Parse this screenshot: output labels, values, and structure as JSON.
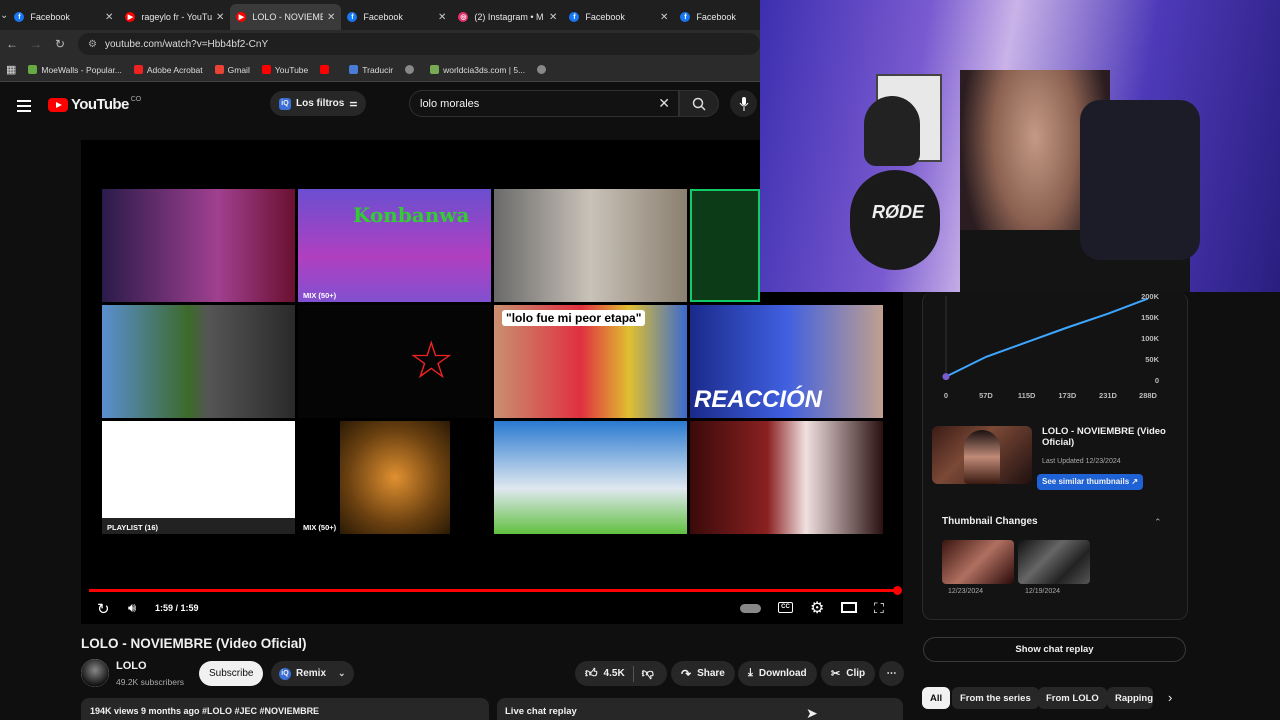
{
  "browser": {
    "tabs": [
      {
        "title": "Facebook",
        "icon": "facebook-icon",
        "color": "#1877f2"
      },
      {
        "title": "rageylo fr - YouTu",
        "icon": "youtube-icon",
        "color": "#ff0000"
      },
      {
        "title": "LOLO - NOVIEMB",
        "icon": "youtube-icon",
        "color": "#ff0000"
      },
      {
        "title": "Facebook",
        "icon": "facebook-icon",
        "color": "#1877f2"
      },
      {
        "title": "(2) Instagram • M",
        "icon": "instagram-icon",
        "color": "#e1306c"
      },
      {
        "title": "Facebook",
        "icon": "facebook-icon",
        "color": "#1877f2"
      },
      {
        "title": "Facebook",
        "icon": "facebook-icon",
        "color": "#1877f2"
      }
    ],
    "url": "youtube.com/watch?v=Hbb4bf2-CnY",
    "bookmarks": [
      "MoeWalls - Popular...",
      "Adobe Acrobat",
      "Gmail",
      "YouTube",
      "",
      "Traducir",
      "",
      "worldcia3ds.com | 5...",
      ""
    ]
  },
  "youtube": {
    "filters_label": "Los filtros",
    "search_value": "lolo morales",
    "player": {
      "end_labels": [
        "MIX (50+)",
        "PLAYLIST (16)",
        "MIX (50+)"
      ],
      "time": "1:59 / 1:59",
      "progress": 1.0
    },
    "video": {
      "title": "LOLO - NOVIEMBRE (Video Oficial)",
      "channel": "LOLO",
      "subscribers": "49.2K subscribers",
      "subscribe": "Subscribe",
      "remix": "Remix",
      "likes": "4.5K",
      "share": "Share",
      "download": "Download",
      "clip": "Clip",
      "description": "194K views  9 months ago  #LOLO #JEC #NOVIEMBRE",
      "live_chat": "Live chat replay"
    },
    "sidebar": {
      "similar_title": "LOLO - NOVIEMBRE (Video Oficial)",
      "last_updated": "Last Updated 12/23/2024",
      "similar_button": "See similar thumbnails ↗",
      "thumb_changes_title": "Thumbnail Changes",
      "change_dates": [
        "12/23/2024",
        "12/19/2024"
      ],
      "show_chat": "Show chat replay",
      "chips": [
        "All",
        "From the series",
        "From LOLO",
        "Rapping"
      ]
    }
  },
  "chart_data": {
    "type": "line",
    "x_ticks": [
      "0",
      "57D",
      "115D",
      "173D",
      "231D",
      "288D"
    ],
    "y_ticks": [
      "200K",
      "150K",
      "100K",
      "50K",
      "0"
    ],
    "x": [
      0,
      57,
      115,
      173,
      231,
      288
    ],
    "y": [
      8000,
      55000,
      90000,
      125000,
      158000,
      194000
    ],
    "ylim": [
      0,
      200000
    ],
    "color": "#3ea6ff"
  }
}
